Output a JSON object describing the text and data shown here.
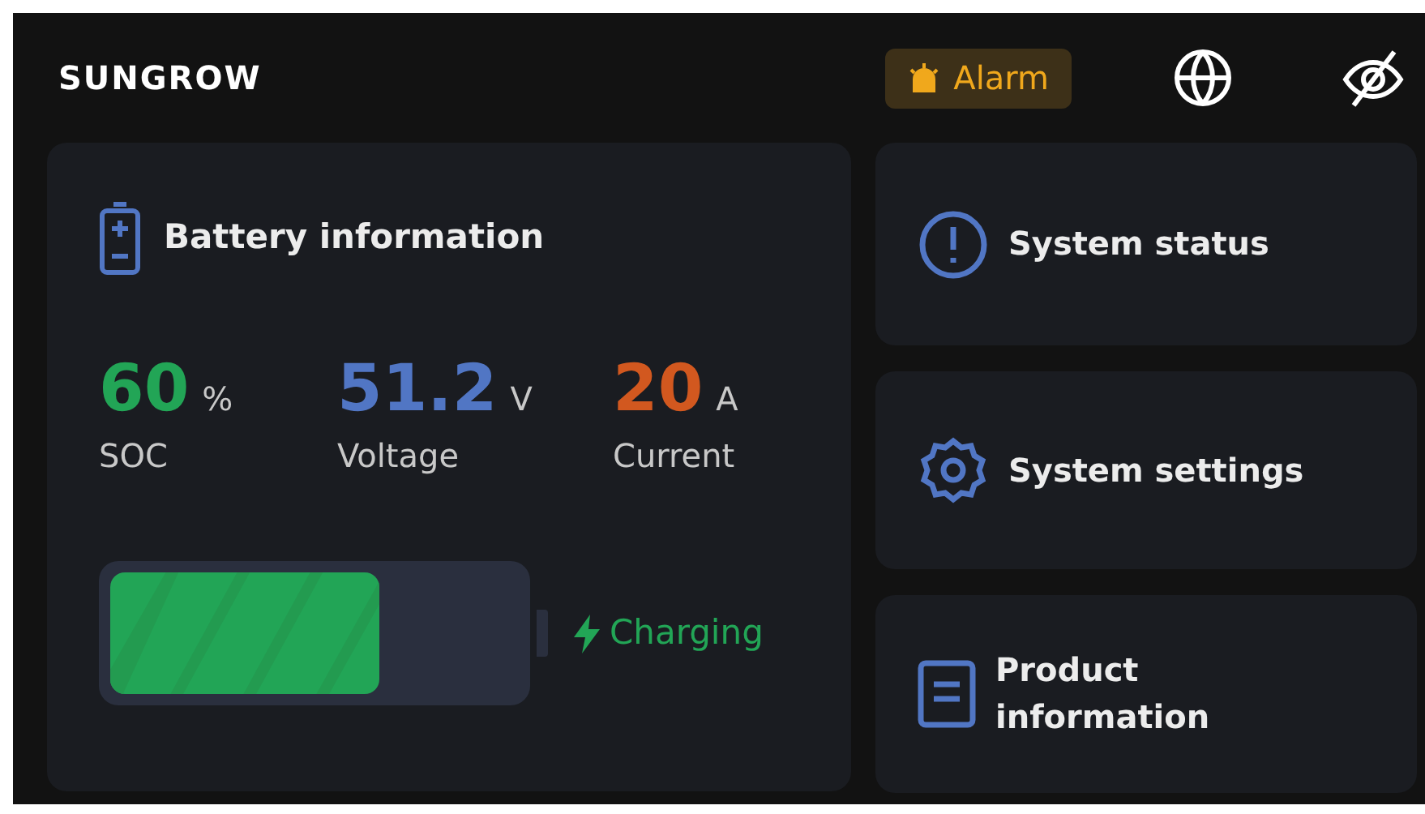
{
  "header": {
    "logo": "SUNGROW",
    "alarm_button": {
      "label": "Alarm"
    }
  },
  "battery_card": {
    "title": "Battery information",
    "stats": [
      {
        "value": "60",
        "unit": "%",
        "label": "SOC",
        "color": "#22a556"
      },
      {
        "value": "51.2",
        "unit": "V",
        "label": "Voltage",
        "color": "#5176c4"
      },
      {
        "value": "20",
        "unit": "A",
        "label": "Current",
        "color": "#d2581f"
      }
    ],
    "battery": {
      "level": 0.66,
      "status": "Charging"
    }
  },
  "menu": [
    {
      "kind": "status",
      "label": "System status"
    },
    {
      "kind": "settings",
      "label": "System settings"
    },
    {
      "kind": "product",
      "label": "Product information"
    }
  ]
}
